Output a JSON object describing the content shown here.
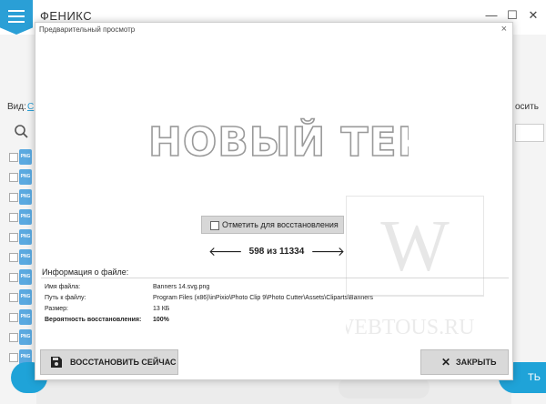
{
  "app": {
    "title": "ФЕНИКС",
    "view_label": "Вид:",
    "view_link": "С",
    "right_partial_text": "осить",
    "bottom_right_partial": "ТЬ",
    "window_controls": {
      "minimize": "—",
      "maximize": "☐",
      "close": "✕"
    }
  },
  "file_list": [
    {
      "ext": "PNG"
    },
    {
      "ext": "PNG"
    },
    {
      "ext": "PNG"
    },
    {
      "ext": "PNG"
    },
    {
      "ext": "PNG"
    },
    {
      "ext": "PNG"
    },
    {
      "ext": "PNG"
    },
    {
      "ext": "PNG"
    },
    {
      "ext": "PNG"
    },
    {
      "ext": "PNG"
    },
    {
      "ext": "PNG"
    }
  ],
  "modal": {
    "title": "Предварительный просмотр",
    "close": "×",
    "preview_text": "НОВЫЙ ТЕКСТ",
    "mark_label": "Отметить для восстановления",
    "nav": {
      "current": "598",
      "separator": "из",
      "total": "11334",
      "prev_icon": "arrow-left-icon",
      "next_icon": "arrow-right-icon"
    },
    "info": {
      "title": "Информация о файле:",
      "rows": [
        {
          "key": "Имя файла:",
          "value": "Banners 14.svg.png"
        },
        {
          "key": "Путь к файлу:",
          "value": "Program Files (x86)\\inPixio\\Photo Clip 9\\Photo Cutter\\Assets\\Cliparts\\Banners"
        },
        {
          "key": "Размер:",
          "value": "13 КБ"
        },
        {
          "key": "Вероятность восстановления:",
          "value": "100%"
        }
      ]
    },
    "restore_button": "ВОССТАНОВИТЬ СЕЙЧАС",
    "close_button": "ЗАКРЫТЬ"
  },
  "watermark": {
    "text": "WEBTOUS.RU"
  },
  "colors": {
    "accent": "#1fa3d8",
    "button_gray": "#d9d9d9"
  }
}
